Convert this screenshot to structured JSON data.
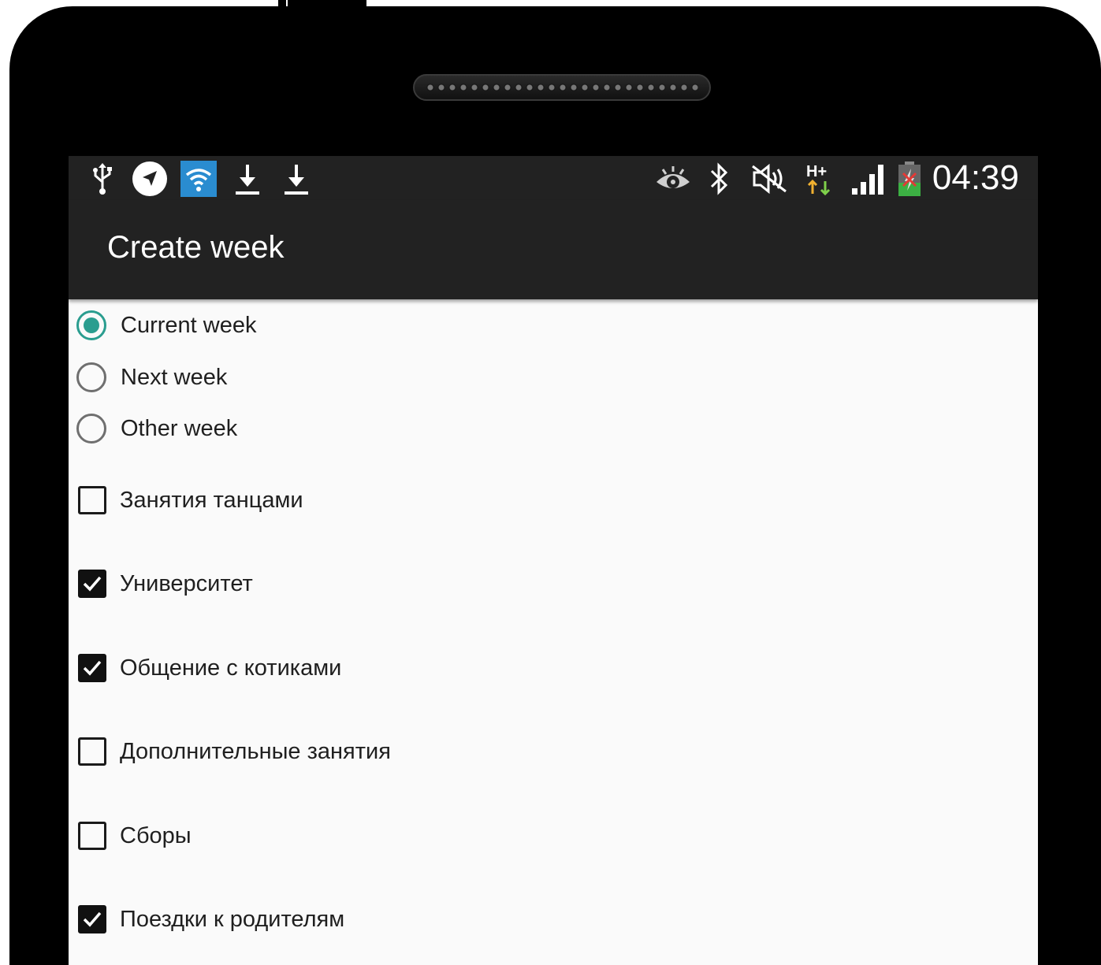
{
  "app_bar": {
    "title": "Create week"
  },
  "status_bar": {
    "time": "04:39",
    "left_icons": [
      "usb-icon",
      "navigation-icon",
      "wifi-icon",
      "download-icon",
      "download-icon"
    ],
    "right_icons": [
      "eye-icon",
      "bluetooth-icon",
      "mute-icon",
      "hplus-data-icon",
      "signal-icon",
      "battery-icon"
    ]
  },
  "week_options": [
    {
      "label": "Current week",
      "selected": true
    },
    {
      "label": "Next week",
      "selected": false
    },
    {
      "label": "Other week",
      "selected": false
    }
  ],
  "activities": [
    {
      "label": "Занятия танцами",
      "checked": false
    },
    {
      "label": "Университет",
      "checked": true
    },
    {
      "label": "Общение с котиками",
      "checked": true
    },
    {
      "label": "Дополнительные занятия",
      "checked": false
    },
    {
      "label": "Сборы",
      "checked": false
    },
    {
      "label": "Поездки к родителям",
      "checked": true
    }
  ],
  "colors": {
    "accent": "#2a9d8f",
    "toolbar": "#222222",
    "background": "#fafafa"
  }
}
